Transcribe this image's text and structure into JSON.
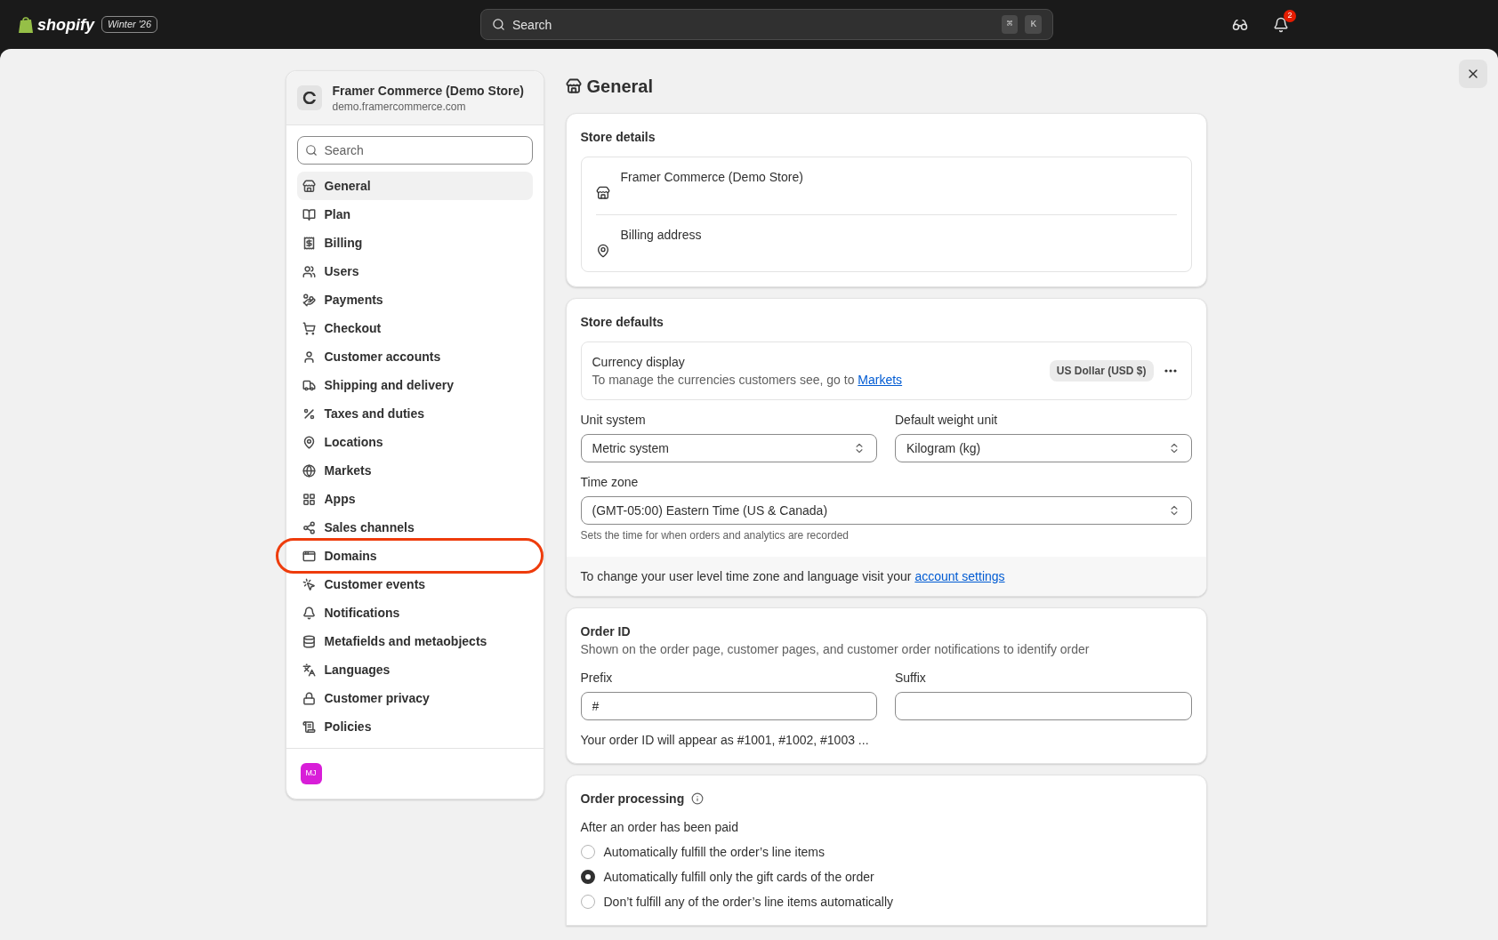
{
  "top_bar": {
    "brand": "shopify",
    "edition": "Winter '26",
    "search": {
      "placeholder": "Search",
      "shortcut": [
        "⌘",
        "K"
      ]
    },
    "notification_count": "2"
  },
  "sidebar": {
    "store_name": "Framer Commerce (Demo Store)",
    "store_domain": "demo.framercommerce.com",
    "search": {
      "placeholder": "Search"
    },
    "items": [
      {
        "label": "General",
        "selected": true,
        "highlighted": false
      },
      {
        "label": "Plan",
        "selected": false,
        "highlighted": false
      },
      {
        "label": "Billing",
        "selected": false,
        "highlighted": false
      },
      {
        "label": "Users",
        "selected": false,
        "highlighted": false
      },
      {
        "label": "Payments",
        "selected": false,
        "highlighted": false
      },
      {
        "label": "Checkout",
        "selected": false,
        "highlighted": false
      },
      {
        "label": "Customer accounts",
        "selected": false,
        "highlighted": false
      },
      {
        "label": "Shipping and delivery",
        "selected": false,
        "highlighted": false
      },
      {
        "label": "Taxes and duties",
        "selected": false,
        "highlighted": false
      },
      {
        "label": "Locations",
        "selected": false,
        "highlighted": false
      },
      {
        "label": "Markets",
        "selected": false,
        "highlighted": false
      },
      {
        "label": "Apps",
        "selected": false,
        "highlighted": false
      },
      {
        "label": "Sales channels",
        "selected": false,
        "highlighted": false
      },
      {
        "label": "Domains",
        "selected": false,
        "highlighted": true
      },
      {
        "label": "Customer events",
        "selected": false,
        "highlighted": false
      },
      {
        "label": "Notifications",
        "selected": false,
        "highlighted": false
      },
      {
        "label": "Metafields and metaobjects",
        "selected": false,
        "highlighted": false
      },
      {
        "label": "Languages",
        "selected": false,
        "highlighted": false
      },
      {
        "label": "Customer privacy",
        "selected": false,
        "highlighted": false
      },
      {
        "label": "Policies",
        "selected": false,
        "highlighted": false
      }
    ],
    "user_initials": "MJ"
  },
  "page": {
    "title": "General",
    "store_details": {
      "title": "Store details",
      "rows": [
        "Framer Commerce (Demo Store)",
        "Billing address"
      ]
    },
    "store_defaults": {
      "title": "Store defaults",
      "currency": {
        "label": "Currency display",
        "description": "To manage the currencies customers see, go to",
        "link": "Markets",
        "badge": "US Dollar (USD $)"
      },
      "unit_system": {
        "label": "Unit system",
        "value": "Metric system"
      },
      "weight_unit": {
        "label": "Default weight unit",
        "value": "Kilogram (kg)"
      },
      "time_zone": {
        "label": "Time zone",
        "value": "(GMT-05:00) Eastern Time (US & Canada)",
        "help": "Sets the time for when orders and analytics are recorded"
      },
      "footer": {
        "text": "To change your user level time zone and language visit your",
        "link": "account settings"
      }
    },
    "order_id": {
      "title": "Order ID",
      "description": "Shown on the order page, customer pages, and customer order notifications to identify order",
      "prefix": {
        "label": "Prefix",
        "value": "#"
      },
      "suffix": {
        "label": "Suffix"
      },
      "preview": "Your order ID will appear as #1001, #1002, #1003 ..."
    },
    "order_processing": {
      "title": "Order processing",
      "subtitle": "After an order has been paid",
      "options": [
        {
          "label": "Automatically fulfill the order’s line items",
          "selected": false
        },
        {
          "label": "Automatically fulfill only the gift cards of the order",
          "selected": true
        },
        {
          "label": "Don’t fulfill any of the order’s line items automatically",
          "selected": false
        }
      ]
    }
  }
}
